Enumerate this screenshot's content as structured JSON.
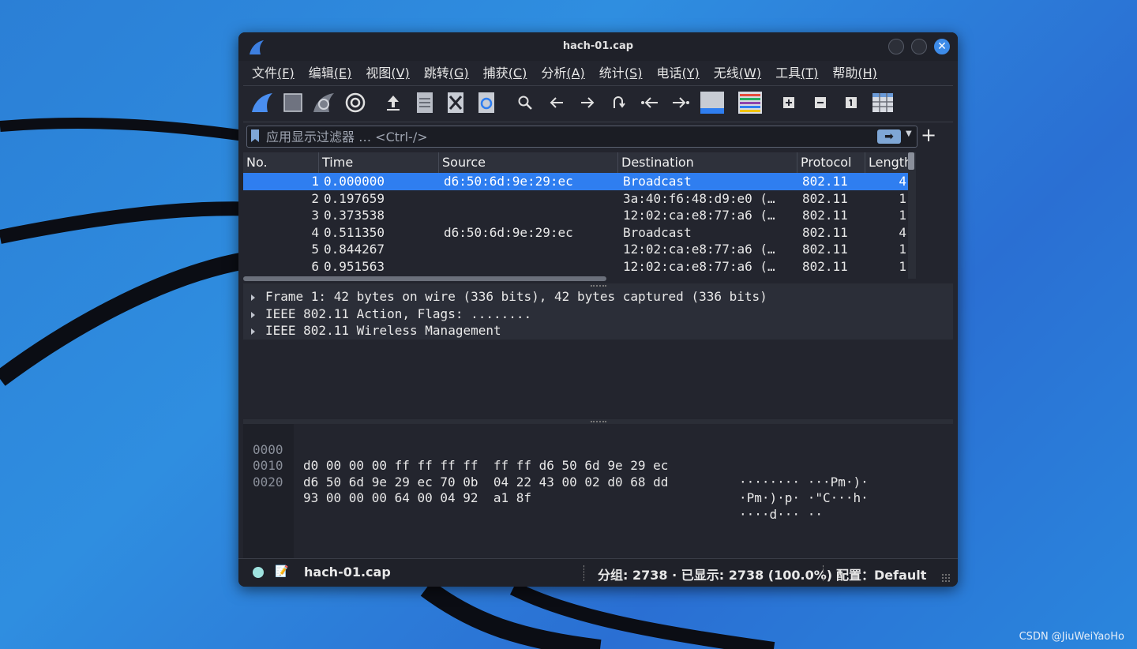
{
  "window": {
    "title": "hach-01.cap",
    "close_glyph": "✕"
  },
  "menu": [
    {
      "label": "文件",
      "hotkey": "(F)"
    },
    {
      "label": "编辑",
      "hotkey": "(E)"
    },
    {
      "label": "视图",
      "hotkey": "(V)"
    },
    {
      "label": "跳转",
      "hotkey": "(G)"
    },
    {
      "label": "捕获",
      "hotkey": "(C)"
    },
    {
      "label": "分析",
      "hotkey": "(A)"
    },
    {
      "label": "统计",
      "hotkey": "(S)"
    },
    {
      "label": "电话",
      "hotkey": "(Y)"
    },
    {
      "label": "无线",
      "hotkey": "(W)"
    },
    {
      "label": "工具",
      "hotkey": "(T)"
    },
    {
      "label": "帮助",
      "hotkey": "(H)"
    }
  ],
  "toolbar_icons": [
    "start-capture-icon",
    "stop-capture-icon",
    "restart-capture-icon",
    "capture-options-icon",
    "open-file-icon",
    "save-file-icon",
    "close-file-icon",
    "reload-file-icon",
    "find-packet-icon",
    "go-back-icon",
    "go-forward-icon",
    "go-to-packet-icon",
    "first-packet-icon",
    "last-packet-icon",
    "autoscroll-icon",
    "colorize-icon",
    "zoom-in-icon",
    "zoom-out-icon",
    "normal-size-icon",
    "resize-columns-icon"
  ],
  "filter": {
    "placeholder": "应用显示过滤器 … <Ctrl-/>",
    "apply_glyph": "➡",
    "add_glyph": "+"
  },
  "packet_list": {
    "columns": [
      "No.",
      "Time",
      "Source",
      "Destination",
      "Protocol",
      "Length"
    ],
    "rows": [
      {
        "no": "1",
        "time": "0.000000",
        "source": "d6:50:6d:9e:29:ec",
        "destination": "Broadcast",
        "protocol": "802.11",
        "length": "4"
      },
      {
        "no": "2",
        "time": "0.197659",
        "source": "",
        "destination": "3a:40:f6:48:d9:e0 (…",
        "protocol": "802.11",
        "length": "1"
      },
      {
        "no": "3",
        "time": "0.373538",
        "source": "",
        "destination": "12:02:ca:e8:77:a6 (…",
        "protocol": "802.11",
        "length": "1"
      },
      {
        "no": "4",
        "time": "0.511350",
        "source": "d6:50:6d:9e:29:ec",
        "destination": "Broadcast",
        "protocol": "802.11",
        "length": "4"
      },
      {
        "no": "5",
        "time": "0.844267",
        "source": "",
        "destination": "12:02:ca:e8:77:a6 (…",
        "protocol": "802.11",
        "length": "1"
      },
      {
        "no": "6",
        "time": "0.951563",
        "source": "",
        "destination": "12:02:ca:e8:77:a6 (…",
        "protocol": "802.11",
        "length": "1"
      }
    ],
    "selected_index": 0,
    "selected_color": "#2f7ef0"
  },
  "details": [
    "Frame 1: 42 bytes on wire (336 bits), 42 bytes captured (336 bits)",
    "IEEE 802.11 Action, Flags: ........",
    "IEEE 802.11 Wireless Management"
  ],
  "hex_dump": [
    {
      "offset": "0000",
      "bytes": "d0 00 00 00 ff ff ff ff  ff ff d6 50 6d 9e 29 ec",
      "ascii": "········ ···Pm·)·"
    },
    {
      "offset": "0010",
      "bytes": "d6 50 6d 9e 29 ec 70 0b  04 22 43 00 02 d0 68 dd",
      "ascii": "·Pm·)·p· ·\"C···h·"
    },
    {
      "offset": "0020",
      "bytes": "93 00 00 00 64 00 04 92  a1 8f",
      "ascii": "····d··· ··"
    }
  ],
  "status": {
    "file": "hach-01.cap",
    "packets": "分组: 2738 · 已显示: 2738 (100.0%)",
    "profile": "配置：Default",
    "edit_glyph": "📝"
  },
  "watermark": "CSDN @JiuWeiYaoHo"
}
